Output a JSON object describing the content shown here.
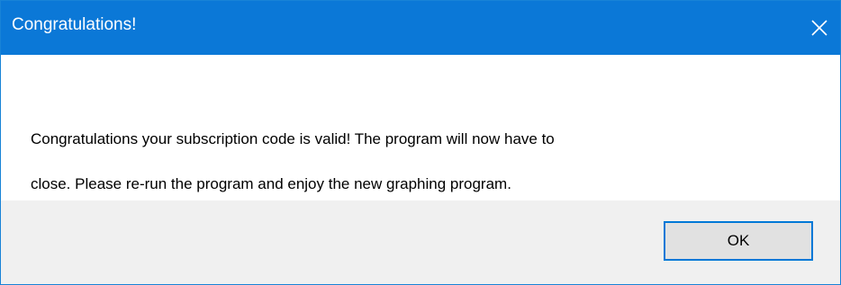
{
  "window": {
    "title": "Congratulations!",
    "close_icon": "close-icon"
  },
  "message": {
    "line1": "Congratulations your subscription code is valid!  The program will now have to",
    "line2": "close.  Please re-run the program and enjoy the new graphing program."
  },
  "buttons": {
    "ok_label": "OK"
  },
  "colors": {
    "titlebar": "#0b78d7",
    "footer": "#f0f0f0",
    "button_border": "#0078d7",
    "button_face": "#e1e1e1"
  }
}
